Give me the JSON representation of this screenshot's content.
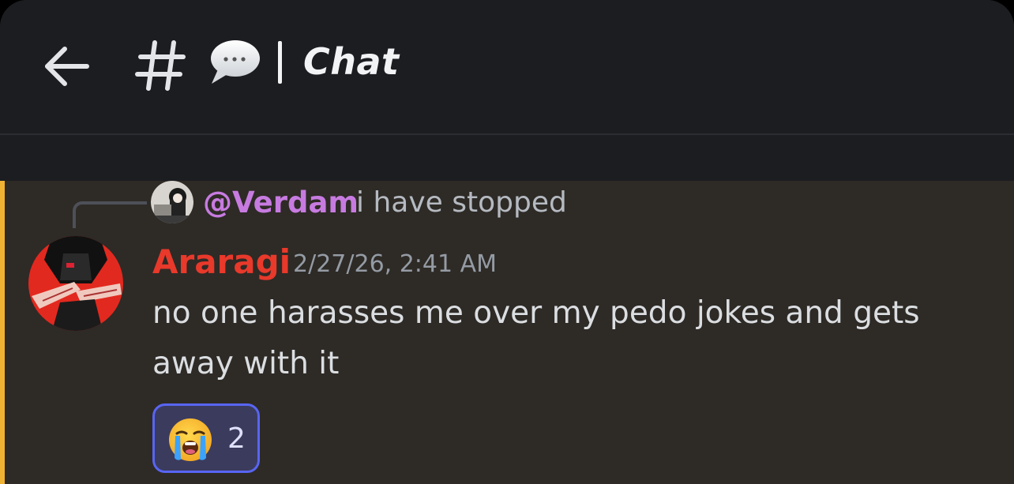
{
  "header": {
    "back_icon": "arrow-left-icon",
    "channel_icon": "hash-icon",
    "channel_emoji": "speech-bubble-icon",
    "separator": "|",
    "channel_name": "Chat"
  },
  "message": {
    "reply": {
      "author": "@Verdam",
      "text": "i have stopped",
      "author_color": "#c77be0"
    },
    "author": "Araragi",
    "author_color": "#e8392b",
    "timestamp": "2/27/26, 2:41 AM",
    "content": "no one harasses me over my pedo jokes and gets away with it",
    "mention_highlight_color": "#f0b232",
    "reactions": [
      {
        "emoji": "loudly-crying-face-icon",
        "count": "2",
        "selected": true
      }
    ]
  },
  "colors": {
    "header_bg": "#1c1d21",
    "message_bg": "#2e2a26",
    "reaction_border": "#5865f2"
  }
}
